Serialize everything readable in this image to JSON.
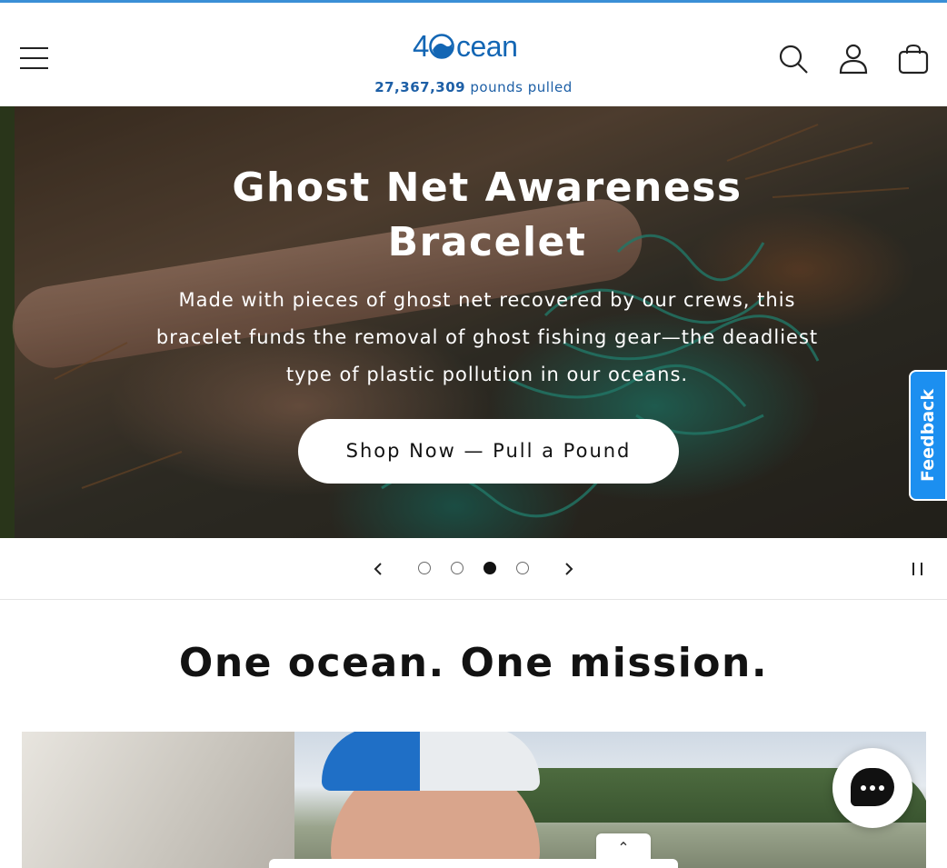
{
  "header": {
    "logo_text": "4Ocean",
    "counter_value": "27,367,309",
    "counter_label": "pounds pulled"
  },
  "hero": {
    "title": "Ghost Net Awareness Bracelet",
    "subtitle": "Made with pieces of ghost net recovered by our crews, this bracelet funds the removal of ghost fishing gear—the deadliest type of plastic pollution in our oceans.",
    "cta_label": "Shop Now — Pull a Pound"
  },
  "slider": {
    "slide_count": 4,
    "active_slide": 3
  },
  "feedback": {
    "label": "Feedback"
  },
  "mission": {
    "title": "One ocean. One mission."
  },
  "colors": {
    "brand_blue": "#1366b4",
    "feedback_blue": "#1c8ff0",
    "text_dark": "#121212"
  },
  "icons": [
    "menu-icon",
    "search-icon",
    "account-icon",
    "cart-icon",
    "chevron-left-icon",
    "chevron-right-icon",
    "pause-icon",
    "chat-icon",
    "chevron-up-icon"
  ]
}
